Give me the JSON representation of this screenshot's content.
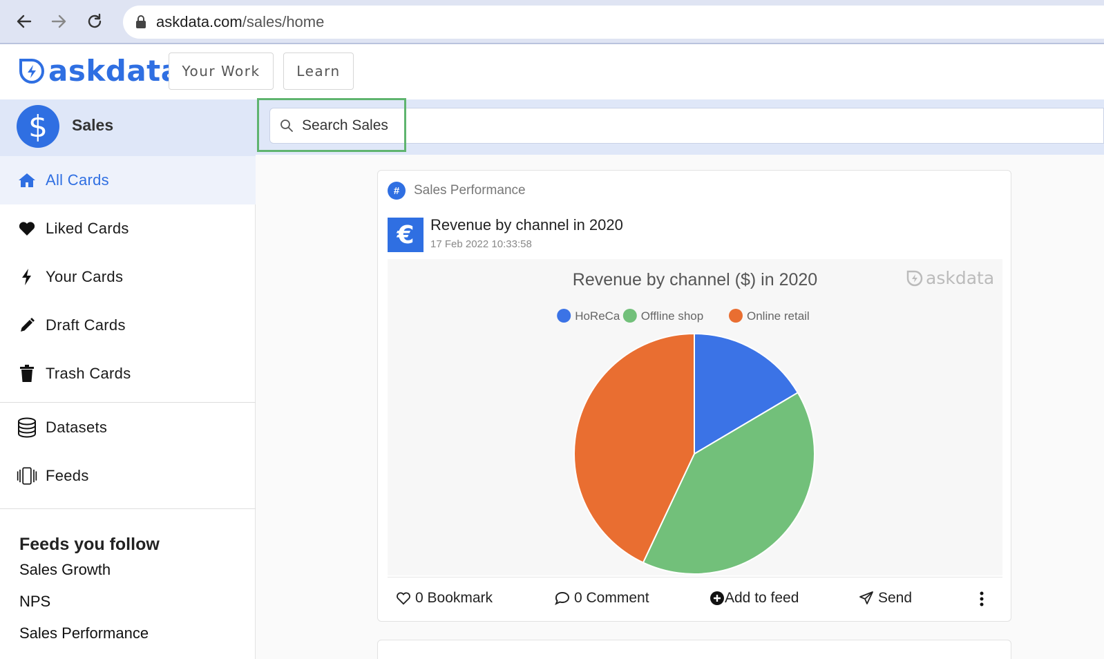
{
  "browser": {
    "url_domain": "askdata.com",
    "url_path": "/sales/home"
  },
  "header": {
    "logo_text": "askdata",
    "nav": [
      "Your Work",
      "Learn"
    ]
  },
  "sidebar": {
    "title": "Sales",
    "items": [
      {
        "label": "All Cards",
        "icon": "home-icon",
        "active": true
      },
      {
        "label": "Liked Cards",
        "icon": "heart-icon"
      },
      {
        "label": "Your Cards",
        "icon": "bolt-icon"
      },
      {
        "label": "Draft Cards",
        "icon": "pencil-icon"
      },
      {
        "label": "Trash Cards",
        "icon": "trash-icon"
      },
      {
        "label": "Datasets",
        "icon": "database-icon"
      },
      {
        "label": "Feeds",
        "icon": "feeds-icon"
      }
    ],
    "feeds_title": "Feeds you follow",
    "feeds": [
      "Sales Growth",
      "NPS",
      "Sales Performance"
    ]
  },
  "search": {
    "placeholder": "Search Sales"
  },
  "card": {
    "tag": "Sales Performance",
    "title": "Revenue by channel in 2020",
    "timestamp": "17 Feb 2022 10:33:58",
    "watermark": "askdata",
    "actions": {
      "bookmark": "0 Bookmark",
      "comment": "0 Comment",
      "add_to_feed": "Add to feed",
      "send": "Send"
    }
  },
  "chart_data": {
    "type": "pie",
    "title": "Revenue by channel ($) in 2020",
    "categories": [
      "HoReCa",
      "Offline shop",
      "Online retail"
    ],
    "values": [
      16.5,
      40.5,
      43
    ],
    "colors": [
      "#3b73e6",
      "#72c07a",
      "#e96e31"
    ],
    "legend": "top-center"
  },
  "colors": {
    "accent": "#2f6fe2",
    "highlight": "#5fb46f"
  }
}
